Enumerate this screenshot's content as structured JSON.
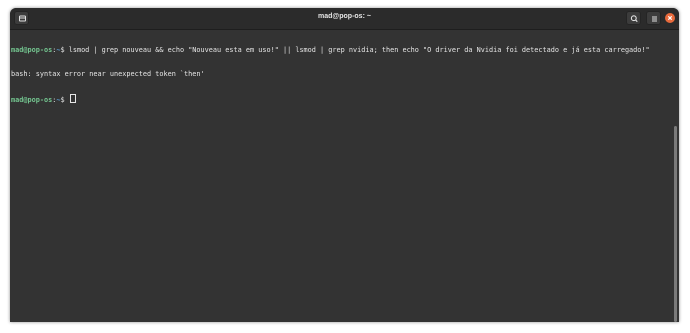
{
  "window": {
    "title": "mad@pop-os: ~"
  },
  "terminal": {
    "lines": [
      {
        "user": "mad@pop-os",
        "sep": ":",
        "path": "~",
        "prompt": "$ ",
        "command": "lsmod | grep nouveau && echo \"Nouveau esta em uso!\" || lsmod | grep nvidia; then echo \"O driver da Nvidia foi detectado e já esta carregado!\""
      },
      {
        "output": "bash: syntax error near unexpected token `then'"
      },
      {
        "user": "mad@pop-os",
        "sep": ":",
        "path": "~",
        "prompt": "$ "
      }
    ]
  },
  "icons": {
    "new_tab": "new-tab-icon",
    "search": "search-icon",
    "menu": "hamburger-menu-icon",
    "close": "close-icon"
  },
  "colors": {
    "background": "#333333",
    "titlebar": "#2b2b2b",
    "user": "#73c48f",
    "path": "#5aa0d8",
    "close": "#e86a3c"
  }
}
